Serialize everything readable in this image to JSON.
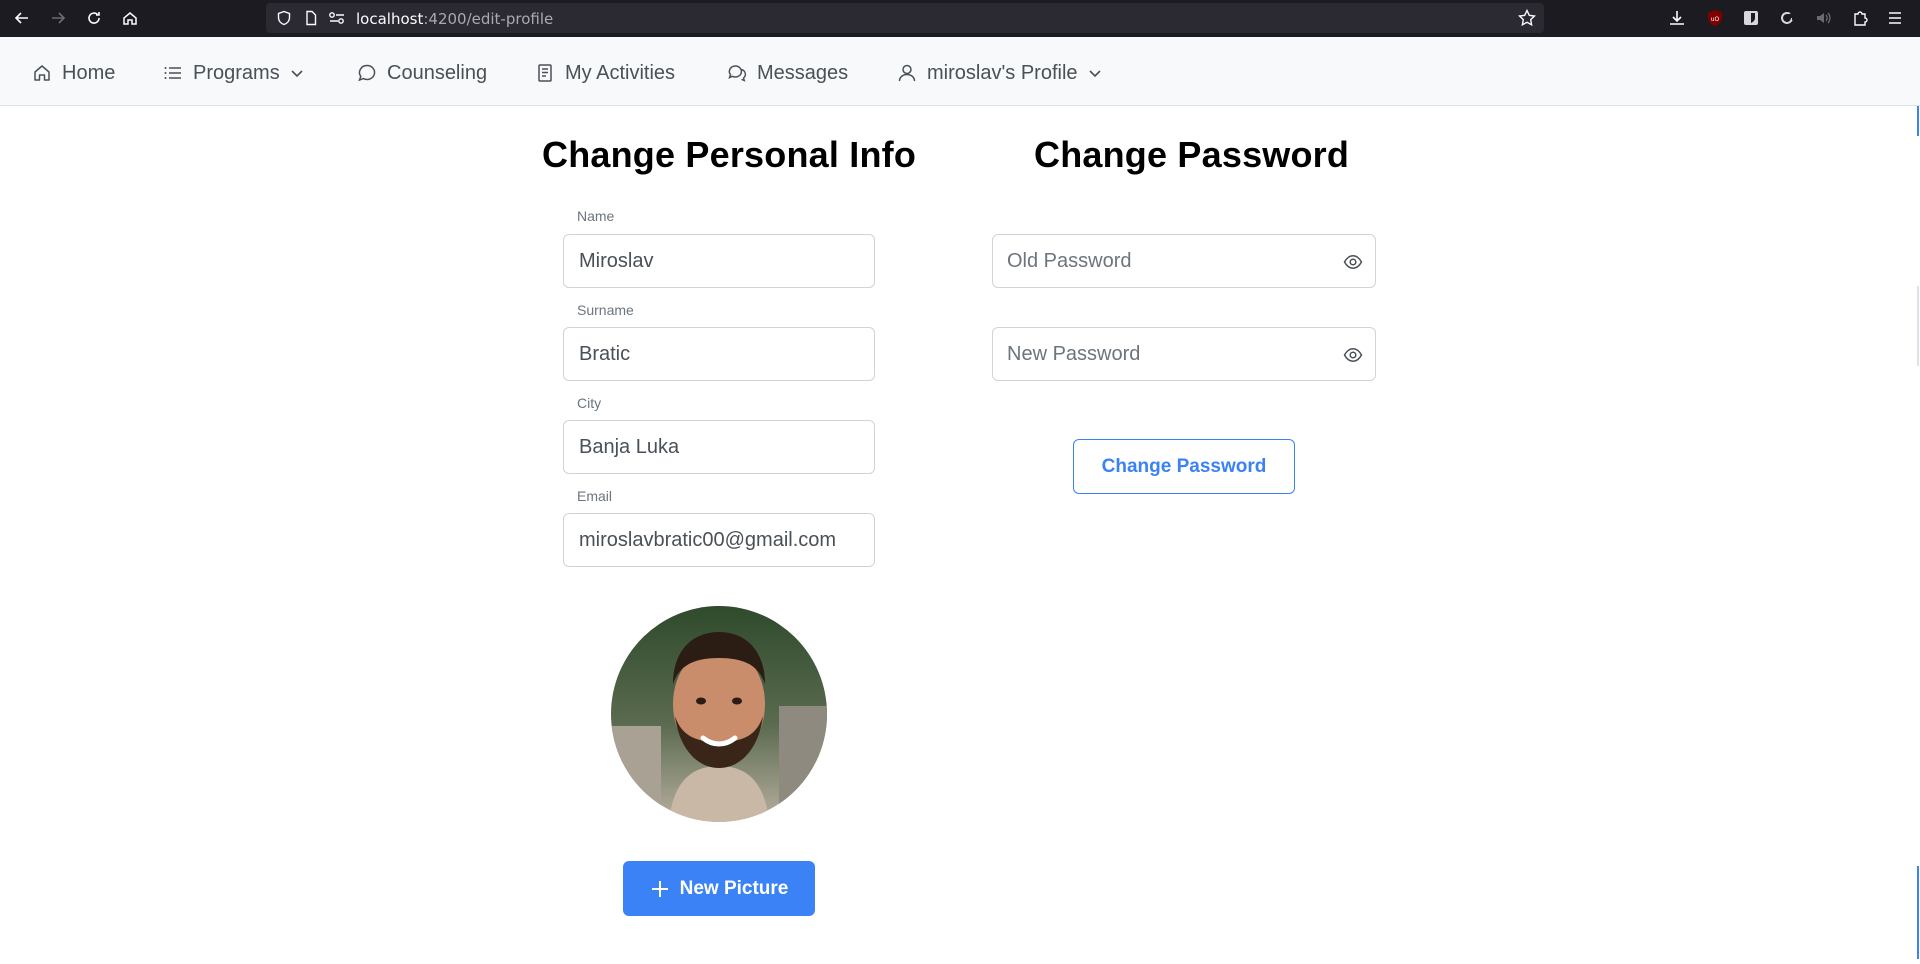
{
  "browser": {
    "url_host": "localhost",
    "url_rest": ":4200/edit-profile"
  },
  "nav": {
    "home": "Home",
    "programs": "Programs",
    "counseling": "Counseling",
    "activities": "My Activities",
    "messages": "Messages",
    "profile": "miroslav's Profile"
  },
  "personal": {
    "title": "Change Personal Info",
    "name_label": "Name",
    "name_value": "Miroslav",
    "surname_label": "Surname",
    "surname_value": "Bratic",
    "city_label": "City",
    "city_value": "Banja Luka",
    "email_label": "Email",
    "email_value": "miroslavbratic00@gmail.com",
    "new_picture": "New Picture"
  },
  "password": {
    "title": "Change Password",
    "old_placeholder": "Old Password",
    "new_placeholder": "New Password",
    "submit": "Change Password"
  },
  "colors": {
    "accent": "#3b82f6",
    "chrome": "#1c1b22",
    "navbar": "#f8f9fa"
  }
}
